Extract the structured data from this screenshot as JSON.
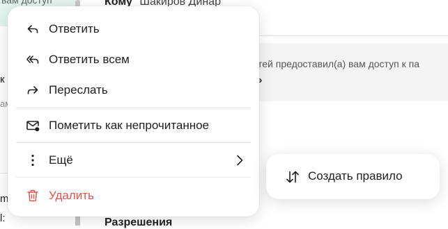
{
  "background": {
    "left_selected_text": "вам доступ",
    "left_fragments": [
      "к",
      "ам",
      "m",
      "l:"
    ],
    "to_label": "Кому",
    "to_value": "Шакиров Динар",
    "notice_line1": "тей предоставил(а) вам доступ к па",
    "notice_line2": "»",
    "section_heading": "Разрешения"
  },
  "menu": {
    "reply": {
      "label": "Ответить",
      "icon": "reply-icon"
    },
    "reply_all": {
      "label": "Ответить всем",
      "icon": "reply-all-icon"
    },
    "forward": {
      "label": "Переслать",
      "icon": "forward-icon"
    },
    "mark_unread": {
      "label": "Пометить как непрочитанное",
      "icon": "mail-unread-icon"
    },
    "more": {
      "label": "Ещё",
      "icon": "more-vertical-icon",
      "submenu_icon": "chevron-right-icon"
    },
    "delete": {
      "label": "Удалить",
      "icon": "trash-icon"
    }
  },
  "create_rule": {
    "label": "Создать правило",
    "icon": "sort-arrows-icon"
  },
  "colors": {
    "danger": "#e5534b",
    "selected_bg": "#e4f4ef",
    "notice_bg": "#f4f4f4"
  }
}
